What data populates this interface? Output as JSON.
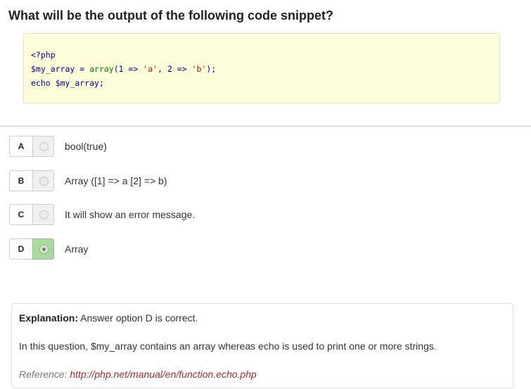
{
  "question": {
    "title": "What will be the output of the following code snippet?"
  },
  "code": {
    "line1": "<?php",
    "line2": {
      "var": "$my_array",
      "eq": " = ",
      "fn": "array",
      "open": "(",
      "n1": "1",
      "arrow1": " => ",
      "s1": "'a'",
      "comma": ", ",
      "n2": "2",
      "arrow2": " => ",
      "s2": "'b'",
      "close": ");"
    },
    "line3": {
      "kw": "echo",
      "sp": " ",
      "var": "$my_array",
      "end": ";"
    }
  },
  "options": [
    {
      "letter": "A",
      "text": "bool(true)",
      "selected": false
    },
    {
      "letter": "B",
      "text": "Array ([1] => a [2] => b)",
      "selected": false
    },
    {
      "letter": "C",
      "text": "It will show an error message.",
      "selected": false
    },
    {
      "letter": "D",
      "text": "Array",
      "selected": true
    }
  ],
  "explanation": {
    "label": "Explanation:",
    "answer": " Answer option D is correct.",
    "body": "In this question, $my_array contains an array whereas echo is used to print one or more strings.",
    "reference_label": "Reference: ",
    "reference_link": "http://php.net/manual/en/function.echo.php"
  },
  "colors": {
    "code_background": "#fdfdd9",
    "selected_option": "#a9d9a0",
    "reference_link": "#9a2a2a"
  }
}
